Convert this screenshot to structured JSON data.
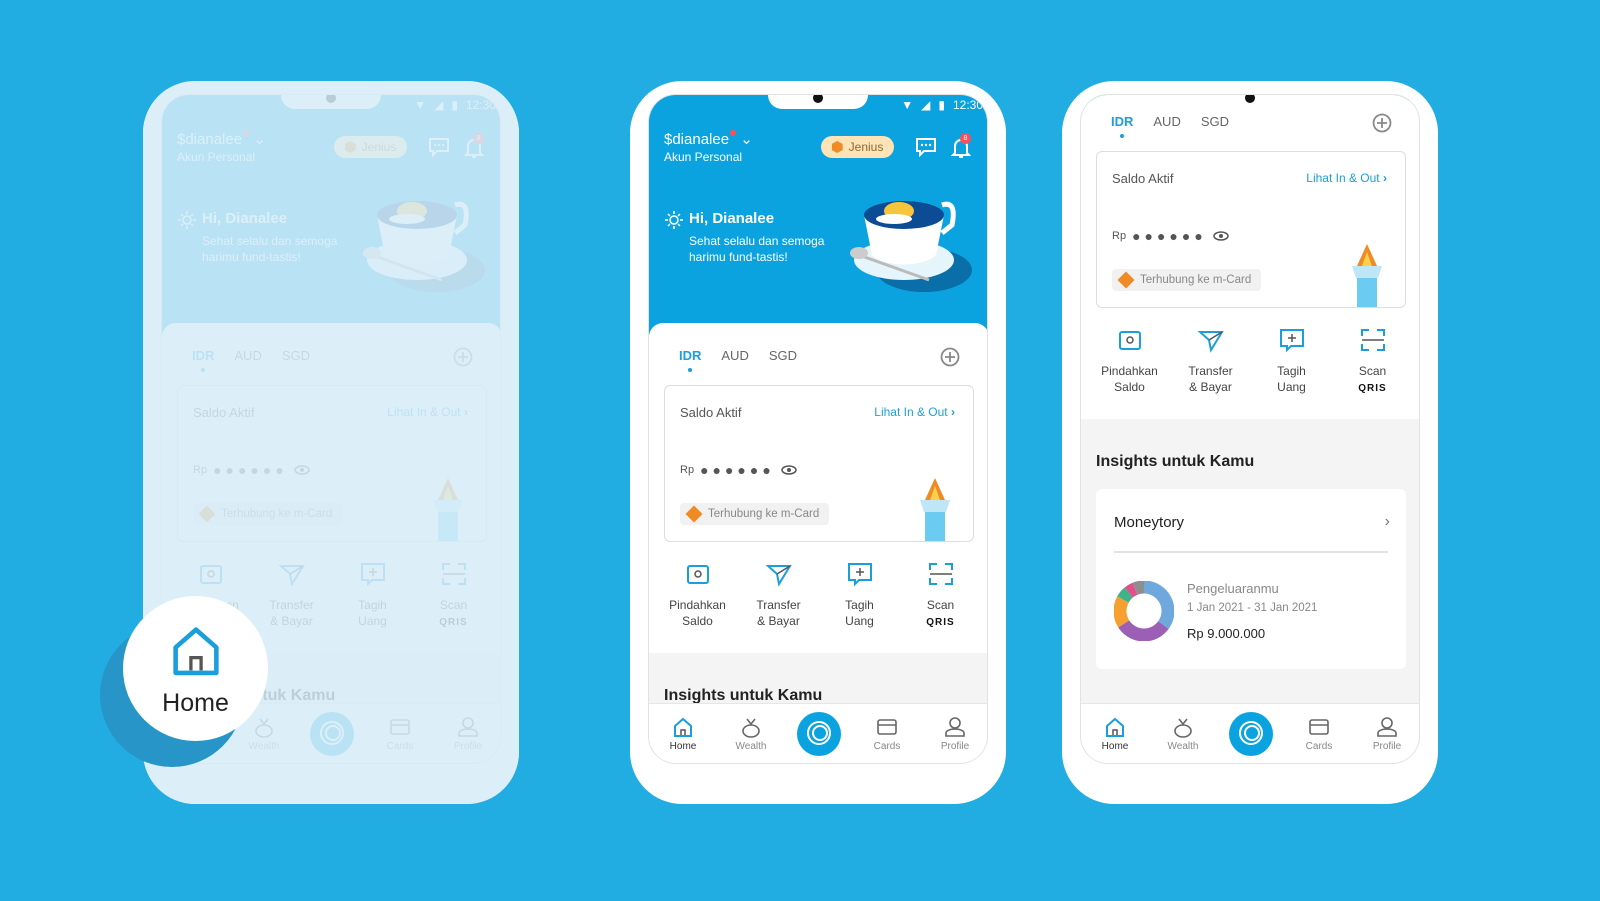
{
  "status": {
    "time": "12:30"
  },
  "header": {
    "username": "$dianalee",
    "account_type": "Akun Personal",
    "tier_badge": "Jenius",
    "notification_count": "8",
    "greeting": "Hi, Dianalee",
    "message": "Sehat selalu dan semoga harimu fund-tastis!"
  },
  "currency_tabs": [
    "IDR",
    "AUD",
    "SGD"
  ],
  "active_currency": "IDR",
  "balance_card": {
    "title": "Saldo Aktif",
    "link": "Lihat In & Out",
    "currency": "Rp",
    "masked_value": "●●●●●●",
    "linked": "Terhubung ke m-Card"
  },
  "actions": [
    {
      "line1": "Pindahkan",
      "line2": "Saldo",
      "icon": "move-balance-icon"
    },
    {
      "line1": "Transfer",
      "line2": "& Bayar",
      "icon": "paper-plane-icon"
    },
    {
      "line1": "Tagih",
      "line2": "Uang",
      "icon": "request-money-icon"
    },
    {
      "line1": "Scan",
      "line2": "QRIS",
      "icon": "scan-icon"
    }
  ],
  "insights": {
    "title": "Insights untuk Kamu",
    "card_title": "Moneytory",
    "label": "Pengeluaranmu",
    "period": "1 Jan 2021 - 31 Jan 2021",
    "amount": "Rp 9.000.000",
    "donut": [
      {
        "fraction": 0.35,
        "color": "#6fa8dc"
      },
      {
        "fraction": 0.31,
        "color": "#9b5fb5"
      },
      {
        "fraction": 0.17,
        "color": "#f5a030"
      },
      {
        "fraction": 0.06,
        "color": "#3cb488"
      },
      {
        "fraction": 0.05,
        "color": "#e0508a"
      },
      {
        "fraction": 0.06,
        "color": "#8e8e8e"
      }
    ]
  },
  "nav": [
    "Home",
    "Wealth",
    "",
    "Cards",
    "Profile"
  ],
  "highlight": {
    "label": "Home"
  },
  "colors": {
    "background": "#22ade2",
    "brand": "#0ba3df",
    "accent": "#1a9fdc"
  }
}
